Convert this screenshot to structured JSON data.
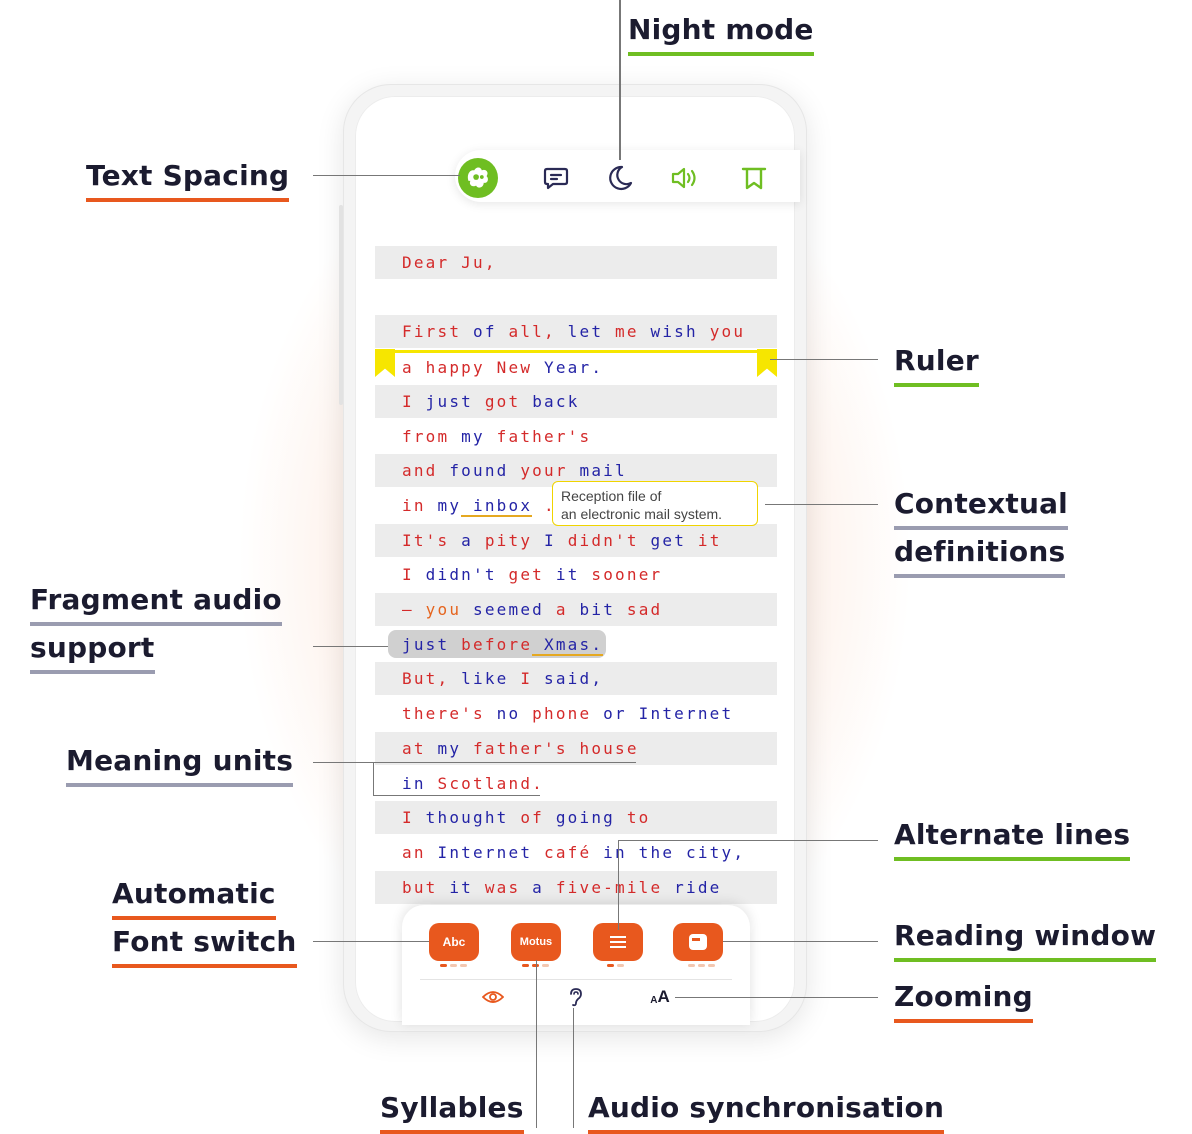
{
  "labels": {
    "night_mode": "Night mode",
    "text_spacing": "Text Spacing",
    "ruler": "Ruler",
    "contextual_definitions_1": "Contextual",
    "contextual_definitions_2": "definitions",
    "fragment_audio_1": "Fragment audio",
    "fragment_audio_2": "support",
    "meaning_units": "Meaning units",
    "alternate_lines": "Alternate lines",
    "auto_font_1": "Automatic",
    "auto_font_2": "Font switch",
    "reading_window": "Reading window",
    "zooming": "Zooming",
    "syllables": "Syllables",
    "audio_sync": "Audio synchronisation"
  },
  "toolbar": {
    "icons": [
      "text-spacing-icon",
      "comment-icon",
      "moon-icon",
      "speaker-icon",
      "bookmark-icon"
    ]
  },
  "reader": {
    "lines": [
      [
        [
          "Dear",
          "r"
        ],
        [
          " Ju,",
          "r"
        ]
      ],
      [],
      [
        [
          "First",
          "r"
        ],
        [
          " of",
          "b"
        ],
        [
          " all,",
          "r"
        ],
        [
          " let",
          "b"
        ],
        [
          " me",
          "r"
        ],
        [
          " wish",
          "b"
        ],
        [
          " you",
          "r"
        ]
      ],
      [
        [
          "a",
          "r"
        ],
        [
          " happy",
          "r"
        ],
        [
          " New",
          "r"
        ],
        [
          " Year.",
          "b"
        ]
      ],
      [
        [
          "I",
          "r"
        ],
        [
          " just",
          "b"
        ],
        [
          " got",
          "r"
        ],
        [
          " back",
          "b"
        ]
      ],
      [
        [
          "from",
          "r"
        ],
        [
          " my",
          "b"
        ],
        [
          " father's",
          "r"
        ]
      ],
      [
        [
          "and",
          "r"
        ],
        [
          " found",
          "b"
        ],
        [
          " your",
          "r"
        ],
        [
          " mail",
          "b"
        ]
      ],
      [
        [
          "in",
          "r"
        ],
        [
          " my",
          "b"
        ],
        [
          " inbox",
          "b"
        ],
        [
          " .",
          "r"
        ]
      ],
      [
        [
          "It's",
          "r"
        ],
        [
          " a",
          "b"
        ],
        [
          " pity",
          "r"
        ],
        [
          " I",
          "b"
        ],
        [
          " didn't",
          "r"
        ],
        [
          " get",
          "b"
        ],
        [
          " it",
          "r"
        ]
      ],
      [
        [
          "I",
          "r"
        ],
        [
          " didn't",
          "b"
        ],
        [
          " get",
          "r"
        ],
        [
          " it",
          "b"
        ],
        [
          " sooner",
          "r"
        ]
      ],
      [
        [
          "–",
          "r"
        ],
        [
          " you",
          "o"
        ],
        [
          " seemed",
          "b"
        ],
        [
          " a",
          "r"
        ],
        [
          " bit",
          "b"
        ],
        [
          " sad",
          "r"
        ]
      ],
      [
        [
          "just",
          "b"
        ],
        [
          " before",
          "r"
        ],
        [
          " Xmas.",
          "b"
        ]
      ],
      [
        [
          "But,",
          "r"
        ],
        [
          " like",
          "b"
        ],
        [
          " I",
          "r"
        ],
        [
          " said,",
          "b"
        ]
      ],
      [
        [
          "there's",
          "r"
        ],
        [
          " no",
          "b"
        ],
        [
          " phone",
          "r"
        ],
        [
          " or",
          "b"
        ],
        [
          " Internet",
          "b"
        ]
      ],
      [
        [
          "at",
          "r"
        ],
        [
          " my",
          "b"
        ],
        [
          " father's",
          "r"
        ],
        [
          " house",
          "r"
        ]
      ],
      [
        [
          "in",
          "b"
        ],
        [
          " Scotland.",
          "r"
        ]
      ],
      [
        [
          "I",
          "r"
        ],
        [
          " thought",
          "b"
        ],
        [
          " of",
          "r"
        ],
        [
          " going",
          "b"
        ],
        [
          " to",
          "r"
        ]
      ],
      [
        [
          "an",
          "r"
        ],
        [
          " Internet",
          "b"
        ],
        [
          " café",
          "r"
        ],
        [
          "  in",
          "b"
        ],
        [
          " the",
          "b"
        ],
        [
          " city,",
          "b"
        ]
      ],
      [
        [
          "but",
          "r"
        ],
        [
          " it",
          "b"
        ],
        [
          " was",
          "r"
        ],
        [
          " a",
          "b"
        ],
        [
          " five-mile",
          "r"
        ],
        [
          " ride",
          "b"
        ]
      ]
    ],
    "definition_line1": "Reception file of",
    "definition_line2": "an electronic mail system."
  },
  "bottom_panel": {
    "abc_label": "Abc",
    "motus_label": "Motus",
    "zoom_label": "AA",
    "zoom_small": "A",
    "zoom_big": "A"
  },
  "colors": {
    "accent_orange": "#e8581e",
    "accent_green": "#6fbe22",
    "ruler_yellow": "#f6e600",
    "word_red": "#d42a2a",
    "word_blue": "#2424a6"
  }
}
